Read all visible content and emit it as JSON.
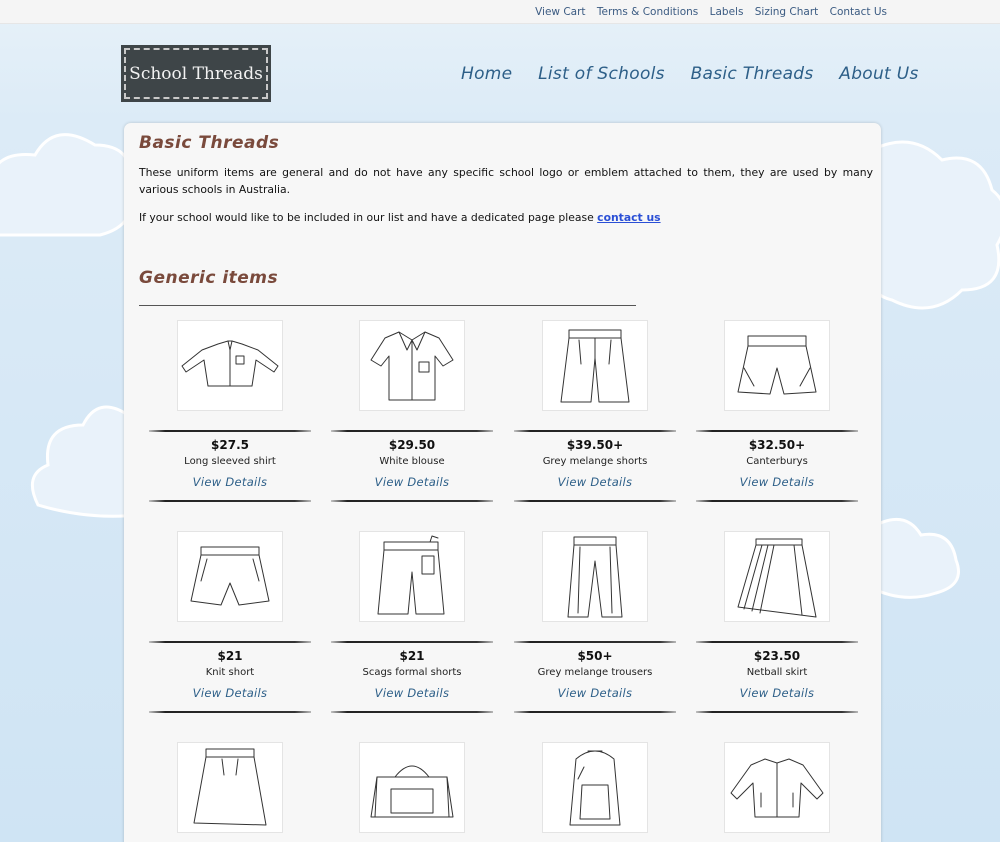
{
  "top_links": [
    "View Cart",
    "Terms & Conditions",
    "Labels",
    "Sizing Chart",
    "Contact Us"
  ],
  "logo": {
    "text": "School Threads"
  },
  "main_nav": [
    "Home",
    "List of Schools",
    "Basic Threads",
    "About Us"
  ],
  "page": {
    "title": "Basic Threads",
    "intro": "These uniform items are general and do not have any specific school logo or emblem attached to them, they are used by many various schools in Australia.",
    "intro2_prefix": "If your school would like to be included in our list and have a dedicated page please",
    "intro2_link": "contact us",
    "section_title": "Generic items"
  },
  "view_details_label": "View Details",
  "products": [
    {
      "price": "$27.5",
      "name": "Long sleeved shirt",
      "icon": "long-sleeved-shirt-icon"
    },
    {
      "price": "$29.50",
      "name": "White blouse",
      "icon": "blouse-icon"
    },
    {
      "price": "$39.50+",
      "name": "Grey melange shorts",
      "icon": "shorts-icon"
    },
    {
      "price": "$32.50+",
      "name": "Canterburys",
      "icon": "canterbury-shorts-icon"
    },
    {
      "price": "$21",
      "name": "Knit short",
      "icon": "knit-short-icon"
    },
    {
      "price": "$21",
      "name": "Scags formal shorts",
      "icon": "formal-shorts-icon"
    },
    {
      "price": "$50+",
      "name": "Grey melange trousers",
      "icon": "trousers-icon"
    },
    {
      "price": "$23.50",
      "name": "Netball skirt",
      "icon": "pleated-skirt-icon"
    },
    {
      "price": "",
      "name": "",
      "icon": "skirt-icon"
    },
    {
      "price": "",
      "name": "",
      "icon": "sports-bag-icon"
    },
    {
      "price": "",
      "name": "",
      "icon": "backpack-icon"
    },
    {
      "price": "",
      "name": "",
      "icon": "jacket-icon"
    }
  ]
}
